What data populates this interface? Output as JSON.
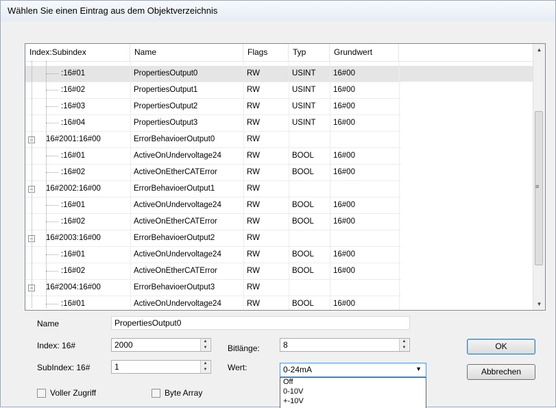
{
  "dialog": {
    "title": "Wählen Sie einen Eintrag aus dem Objektverzeichnis"
  },
  "table": {
    "columns": [
      "Index:Subindex",
      "Name",
      "Flags",
      "Typ",
      "Grundwert"
    ],
    "rows": [
      {
        "index": ":16#01",
        "name": "PropertiesOutput0",
        "flags": "RW",
        "typ": "USINT",
        "grundwert": "16#00",
        "level": 1,
        "selected": true
      },
      {
        "index": ":16#02",
        "name": "PropertiesOutput1",
        "flags": "RW",
        "typ": "USINT",
        "grundwert": "16#00",
        "level": 1
      },
      {
        "index": ":16#03",
        "name": "PropertiesOutput2",
        "flags": "RW",
        "typ": "USINT",
        "grundwert": "16#00",
        "level": 1
      },
      {
        "index": ":16#04",
        "name": "PropertiesOutput3",
        "flags": "RW",
        "typ": "USINT",
        "grundwert": "16#00",
        "level": 1
      },
      {
        "index": "16#2001:16#00",
        "name": "ErrorBehavioerOutput0",
        "flags": "RW",
        "typ": "",
        "grundwert": "",
        "level": 0,
        "expander": "−"
      },
      {
        "index": ":16#01",
        "name": "ActiveOnUndervoltage24",
        "flags": "RW",
        "typ": "BOOL",
        "grundwert": "16#00",
        "level": 1
      },
      {
        "index": ":16#02",
        "name": "ActiveOnEtherCATError",
        "flags": "RW",
        "typ": "BOOL",
        "grundwert": "16#00",
        "level": 1
      },
      {
        "index": "16#2002:16#00",
        "name": "ErrorBehavioerOutput1",
        "flags": "RW",
        "typ": "",
        "grundwert": "",
        "level": 0,
        "expander": "−"
      },
      {
        "index": ":16#01",
        "name": "ActiveOnUndervoltage24",
        "flags": "RW",
        "typ": "BOOL",
        "grundwert": "16#00",
        "level": 1
      },
      {
        "index": ":16#02",
        "name": "ActiveOnEtherCATError",
        "flags": "RW",
        "typ": "BOOL",
        "grundwert": "16#00",
        "level": 1
      },
      {
        "index": "16#2003:16#00",
        "name": "ErrorBehavioerOutput2",
        "flags": "RW",
        "typ": "",
        "grundwert": "",
        "level": 0,
        "expander": "−"
      },
      {
        "index": ":16#01",
        "name": "ActiveOnUndervoltage24",
        "flags": "RW",
        "typ": "BOOL",
        "grundwert": "16#00",
        "level": 1
      },
      {
        "index": ":16#02",
        "name": "ActiveOnEtherCATError",
        "flags": "RW",
        "typ": "BOOL",
        "grundwert": "16#00",
        "level": 1
      },
      {
        "index": "16#2004:16#00",
        "name": "ErrorBehavioerOutput3",
        "flags": "RW",
        "typ": "",
        "grundwert": "",
        "level": 0,
        "expander": "−"
      },
      {
        "index": ":16#01",
        "name": "ActiveOnUndervoltage24",
        "flags": "RW",
        "typ": "BOOL",
        "grundwert": "16#00",
        "level": 1
      }
    ]
  },
  "form": {
    "name_label": "Name",
    "name_value": "PropertiesOutput0",
    "index_label": "Index: 16#",
    "index_value": "2000",
    "subindex_label": "SubIndex: 16#",
    "subindex_value": "1",
    "bitlaenge_label": "Bitlänge:",
    "bitlaenge_value": "8",
    "wert_label": "Wert:",
    "wert_value": "0-24mA",
    "wert_options": [
      "Off",
      "0-10V",
      "+-10V"
    ],
    "voller_zugriff_label": "Voller Zugriff",
    "byte_array_label": "Byte Array",
    "ok_label": "OK",
    "abbrechen_label": "Abbrechen"
  }
}
